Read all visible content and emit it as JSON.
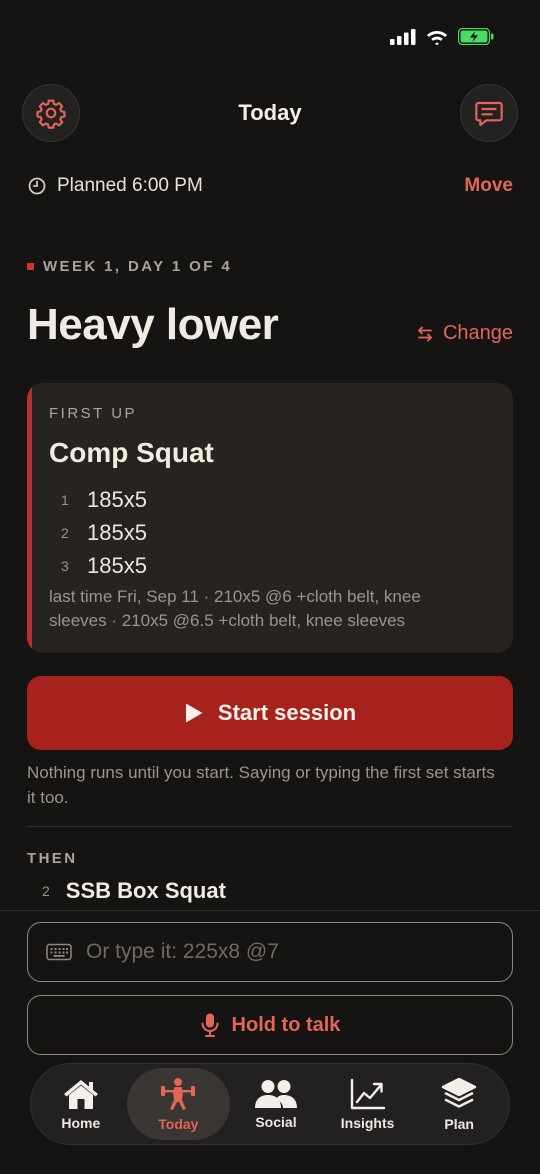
{
  "header": {
    "title": "Today"
  },
  "schedule": {
    "planned_label": "Planned 6:00 PM",
    "move_label": "Move"
  },
  "session": {
    "week_label": "WEEK 1, DAY 1 OF 4",
    "title": "Heavy lower",
    "change_label": "Change"
  },
  "first_up": {
    "eyebrow": "FIRST UP",
    "exercise": "Comp Squat",
    "sets": [
      {
        "num": "1",
        "value": "185x5"
      },
      {
        "num": "2",
        "value": "185x5"
      },
      {
        "num": "3",
        "value": "185x5"
      }
    ],
    "last_time": "last time Fri, Sep 11 · 210x5 @6 +cloth belt, knee sleeves · 210x5 @6.5 +cloth belt, knee sleeves"
  },
  "start": {
    "label": "Start session",
    "hint": "Nothing runs until you start. Saying or typing the first set starts it too."
  },
  "then": {
    "label": "THEN",
    "next_num": "2",
    "next_name": "SSB Box Squat"
  },
  "input": {
    "placeholder": "Or type it: 225x8 @7",
    "value": ""
  },
  "talk": {
    "label": "Hold to talk"
  },
  "tabs": [
    {
      "label": "Home",
      "icon": "home-icon"
    },
    {
      "label": "Today",
      "icon": "barbell-lifter-icon"
    },
    {
      "label": "Social",
      "icon": "people-icon"
    },
    {
      "label": "Insights",
      "icon": "trend-chart-icon"
    },
    {
      "label": "Plan",
      "icon": "layers-icon"
    }
  ],
  "colors": {
    "accent": "#E2665A",
    "primary_button": "#A7221D",
    "card_accent": "#B8302A",
    "background": "#151413",
    "battery": "#4CD964"
  }
}
